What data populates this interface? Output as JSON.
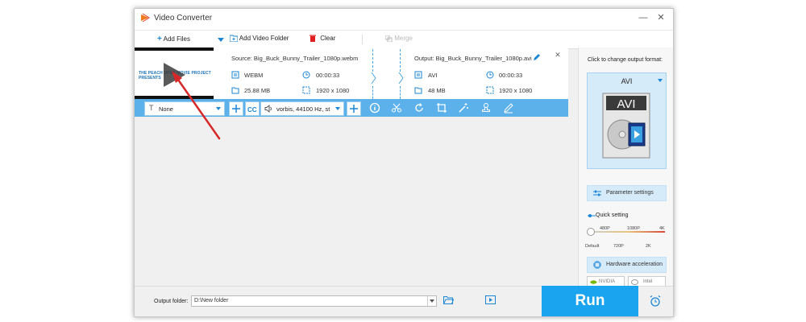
{
  "window": {
    "title": "Video Converter",
    "controls": [
      "minimize-icon",
      "close-icon"
    ]
  },
  "toolbar": {
    "add_files": "Add Files",
    "add_video_folder": "Add Video Folder",
    "clear": "Clear",
    "merge": "Merge"
  },
  "file": {
    "thumbnail_text": "THE PEACH OPEN MOVIE PROJECT PRESENTS",
    "source_label": "Source: Big_Buck_Bunny_Trailer_1080p.webm",
    "source": {
      "format": "WEBM",
      "duration": "00:00:33",
      "size": "25.88 MB",
      "resolution": "1920 x 1080"
    },
    "output_label": "Output: Big_Buck_Bunny_Trailer_1080p.avi",
    "output": {
      "format": "AVI",
      "duration": "00:00:33",
      "size": "48 MB",
      "resolution": "1920 x 1080"
    }
  },
  "edit_bar": {
    "subtitle_value": "None",
    "audio_value": "vorbis, 44100 Hz, st",
    "tools": [
      "info-icon",
      "cut-icon",
      "rotate-icon",
      "crop-icon",
      "effects-icon",
      "watermark-icon",
      "edit-icon"
    ]
  },
  "right_panel": {
    "hint": "Click to change output format:",
    "format": "AVI",
    "format_icon_text": "AVI",
    "parameter_settings": "Parameter settings",
    "quick_setting": "Quick setting",
    "quality_top": [
      "480P",
      "1080P",
      "4K"
    ],
    "quality_bottom": [
      "Default",
      "720P",
      "2K"
    ],
    "quality_level": 0,
    "hardware_acceleration": "Hardware acceleration",
    "nvidia": "NVIDIA",
    "intel": "Intel"
  },
  "bottom": {
    "output_folder_label": "Output folder:",
    "output_folder_value": "D:\\New folder",
    "run": "Run"
  },
  "colors": {
    "accent": "#1aa3ef",
    "edit_bar": "#5cb1ea",
    "annotation_arrow": "#d62828",
    "clear_icon": "#e02020"
  }
}
